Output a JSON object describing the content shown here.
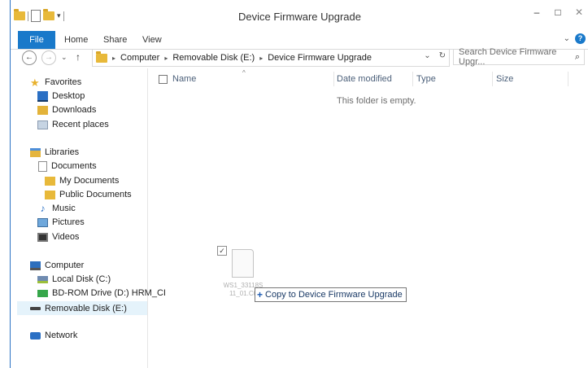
{
  "window": {
    "title": "Device Firmware Upgrade",
    "controls": {
      "minimize": "–",
      "maximize": "□",
      "close": "✕"
    }
  },
  "ribbon": {
    "tabs": [
      "File",
      "Home",
      "Share",
      "View"
    ],
    "expand_chevron": "⌄",
    "help": "?"
  },
  "address_bar": {
    "back": "←",
    "forward": "→",
    "recent_chevron": "⌄",
    "up": "↑",
    "crumbs": [
      "Computer",
      "Removable Disk (E:)",
      "Device Firmware Upgrade"
    ],
    "dropdown": "⌄",
    "refresh": "↻"
  },
  "search": {
    "placeholder": "Search Device Firmware Upgr...",
    "icon": "⌕"
  },
  "nav": {
    "favorites": {
      "label": "Favorites",
      "items": [
        "Desktop",
        "Downloads",
        "Recent places"
      ]
    },
    "libraries": {
      "label": "Libraries",
      "documents": "Documents",
      "doc_children": [
        "My Documents",
        "Public Documents"
      ],
      "items": [
        "Music",
        "Pictures",
        "Videos"
      ]
    },
    "computer": {
      "label": "Computer",
      "items": [
        "Local Disk (C:)",
        "BD-ROM Drive (D:) HRM_CI",
        "Removable Disk (E:)"
      ]
    },
    "network": {
      "label": "Network"
    }
  },
  "columns": [
    "Name",
    "Date modified",
    "Type",
    "Size"
  ],
  "sort_indicator": "^",
  "empty_message": "This folder is empty.",
  "drag": {
    "check": "✓",
    "file_name": "WS1_33118S\n11_01.C0",
    "tooltip_icon": "+",
    "tooltip_text": "Copy to Device Firmware Upgrade"
  }
}
